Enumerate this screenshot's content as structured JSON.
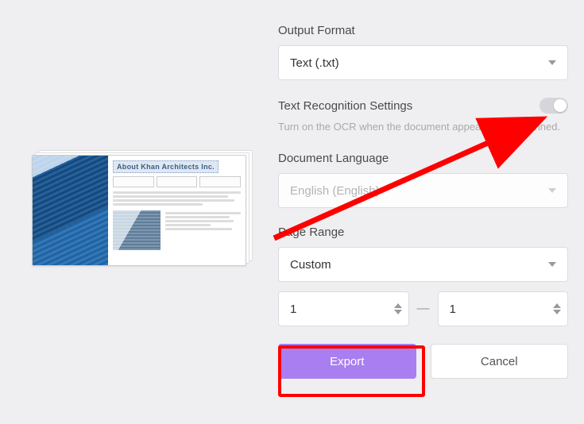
{
  "thumbnail": {
    "title": "About Khan Architects Inc."
  },
  "outputFormat": {
    "label": "Output Format",
    "value": "Text (.txt)"
  },
  "ocr": {
    "label": "Text Recognition Settings",
    "hint": "Turn on the OCR when the document appears to be scanned."
  },
  "language": {
    "label": "Document Language",
    "value": "English (English)"
  },
  "pageRange": {
    "label": "Page Range",
    "mode": "Custom",
    "from": "1",
    "to": "1"
  },
  "buttons": {
    "export": "Export",
    "cancel": "Cancel"
  }
}
